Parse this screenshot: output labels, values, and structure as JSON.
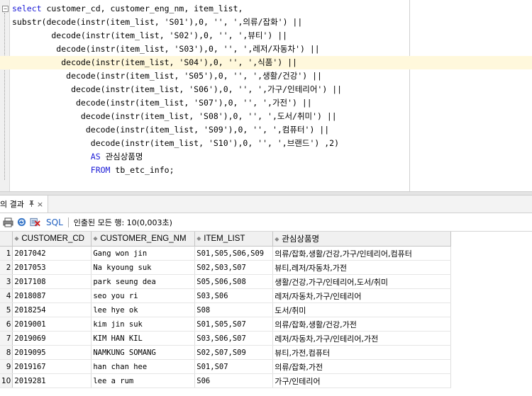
{
  "editor": {
    "lines": [
      [
        {
          "t": "select",
          "kw": true
        },
        {
          "t": " customer_cd, customer_eng_nm, item_list,"
        }
      ],
      [
        {
          "t": "substr(decode(instr(item_list, 'S01'),0, '', ',의류/잡화') ||"
        }
      ],
      [
        {
          "t": "        decode(instr(item_list, 'S02'),0, '', ',뷰티') ||"
        }
      ],
      [
        {
          "t": "         decode(instr(item_list, 'S03'),0, '', ',레저/자동차') ||"
        }
      ],
      [
        {
          "t": "          decode(instr(item_list, 'S04'),0, '', ',식품') ||"
        }
      ],
      [
        {
          "t": "           decode(instr(item_list, 'S05'),0, '', ',생활/건강') ||"
        }
      ],
      [
        {
          "t": "            decode(instr(item_list, 'S06'),0, '', ',가구/인테리어') ||"
        }
      ],
      [
        {
          "t": "             decode(instr(item_list, 'S07'),0, '', ',가전') ||"
        }
      ],
      [
        {
          "t": "              decode(instr(item_list, 'S08'),0, '', ',도서/취미') ||"
        }
      ],
      [
        {
          "t": "               decode(instr(item_list, 'S09'),0, '', ',컴퓨터') ||"
        }
      ],
      [
        {
          "t": "                decode(instr(item_list, 'S10'),0, '', ',브랜드') ,2)"
        }
      ],
      [
        {
          "t": "                "
        },
        {
          "t": "AS",
          "kw": true
        },
        {
          "t": " 관심상품명"
        }
      ],
      [
        {
          "t": "                "
        },
        {
          "t": "FROM",
          "kw": true
        },
        {
          "t": " tb_etc_info;"
        }
      ]
    ],
    "highlighted_line": 4
  },
  "result_tab": {
    "label": "의 결과",
    "pin_icon": "pin-icon",
    "close_icon": "close-icon"
  },
  "toolbar": {
    "sql_label": "SQL",
    "fetch_message": "인출된 모든 행: 10(0,003초)"
  },
  "grid": {
    "columns": [
      "CUSTOMER_CD",
      "CUSTOMER_ENG_NM",
      "ITEM_LIST",
      "관심상품명"
    ],
    "rows": [
      [
        "1",
        "2017042",
        "Gang won jin",
        "S01,S05,S06,S09",
        "의류/잡화,생활/건강,가구/인테리어,컴퓨터"
      ],
      [
        "2",
        "2017053",
        "Na kyoung suk",
        "S02,S03,S07",
        "뷰티,레저/자동차,가전"
      ],
      [
        "3",
        "2017108",
        "park seung dea",
        "S05,S06,S08",
        "생활/건강,가구/인테리어,도서/취미"
      ],
      [
        "4",
        "2018087",
        "seo you ri",
        "S03,S06",
        "레저/자동차,가구/인테리어"
      ],
      [
        "5",
        "2018254",
        "lee hye ok",
        "S08",
        "도서/취미"
      ],
      [
        "6",
        "2019001",
        "kim jin suk",
        "S01,S05,S07",
        "의류/잡화,생활/건강,가전"
      ],
      [
        "7",
        "2019069",
        "KIM HAN KIL",
        "S03,S06,S07",
        "레저/자동차,가구/인테리어,가전"
      ],
      [
        "8",
        "2019095",
        "NAMKUNG SOMANG",
        "S02,S07,S09",
        "뷰티,가전,컴퓨터"
      ],
      [
        "9",
        "2019167",
        "han chan hee",
        "S01,S07",
        "의류/잡화,가전"
      ],
      [
        "10",
        "2019281",
        "lee a rum",
        "S06",
        "가구/인테리어"
      ]
    ]
  },
  "colors": {
    "keyword": "#1a1ad6",
    "highlight": "#fff8dc",
    "sql_label": "#2060c0"
  }
}
